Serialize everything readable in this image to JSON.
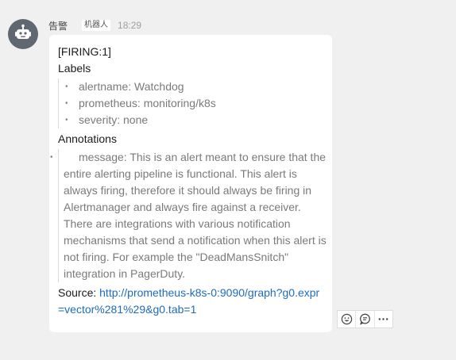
{
  "message": {
    "sender": "告警",
    "badge": "机器人",
    "time": "18:29",
    "status": "[FIRING:1]",
    "labels_title": "Labels",
    "labels": [
      "alertname: Watchdog",
      "prometheus: monitoring/k8s",
      "severity: none"
    ],
    "annotations_title": "Annotations",
    "annotation_message": "message: This is an alert meant to ensure that the entire alerting pipeline is functional. This alert is always firing, therefore it should always be firing in Alertmanager and always fire against a receiver. There are integrations with various notification mechanisms that send a notification when this alert is not firing. For example the \"DeadMansSnitch\" integration in PagerDuty.",
    "source_label": "Source: ",
    "source_link": "http://prometheus-k8s-0:9090/graph?g0.expr=vector%281%29&g0.tab=1"
  },
  "icons": {
    "avatar": "robot-icon",
    "actions": [
      "emoji-icon",
      "comment-icon",
      "more-icon"
    ]
  },
  "colors": {
    "link": "#1d6bbf",
    "avatar_bg": "#5f6770"
  }
}
